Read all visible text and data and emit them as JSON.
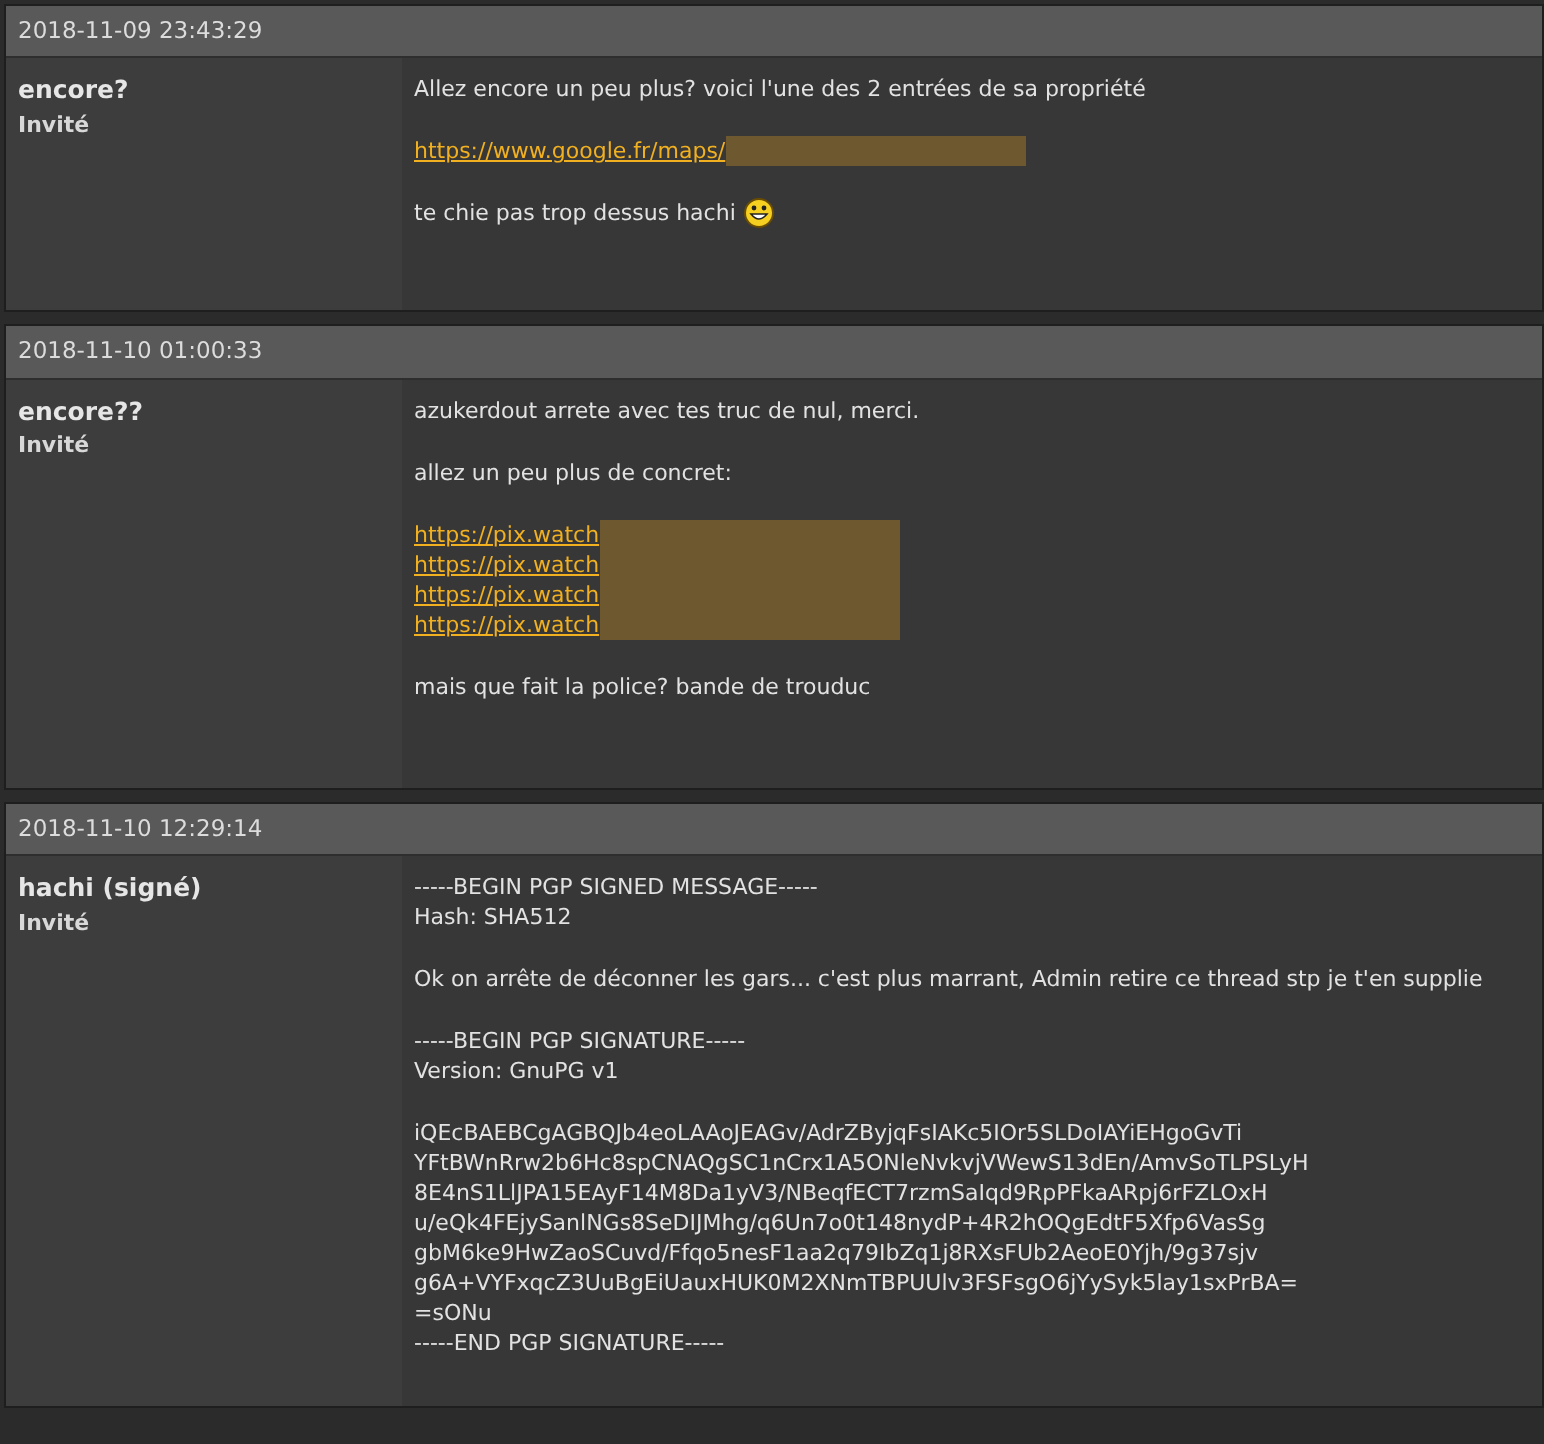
{
  "posts": [
    {
      "date": "2018-11-09 23:43:29",
      "author": "encore?",
      "role": "Invité",
      "paragraphs": [
        [
          {
            "kind": "text",
            "text": "Allez encore un peu plus? voici l'une des 2 entrées de sa propriété"
          }
        ],
        [
          {
            "kind": "link",
            "text": "https://www.google.fr/maps/",
            "redacted": true
          }
        ],
        [
          {
            "kind": "text",
            "text": "te chie pas trop dessus hachi",
            "smiley": true
          }
        ]
      ]
    },
    {
      "date": "2018-11-10 01:00:33",
      "author": "encore??",
      "role": "Invité",
      "paragraphs": [
        [
          {
            "kind": "text",
            "text": "azukerdout arrete avec tes truc de nul, merci."
          }
        ],
        [
          {
            "kind": "text",
            "text": "allez un peu plus de concret:"
          }
        ],
        [
          {
            "kind": "link",
            "text": "https://pix.watch",
            "redacted": true
          },
          {
            "kind": "link",
            "text": "https://pix.watch",
            "redacted": true
          },
          {
            "kind": "link",
            "text": "https://pix.watch",
            "redacted": true
          },
          {
            "kind": "link",
            "text": "https://pix.watch",
            "redacted": true
          }
        ],
        [
          {
            "kind": "text",
            "text": "mais que fait la police? bande de trouduc"
          }
        ]
      ]
    },
    {
      "date": "2018-11-10 12:29:14",
      "author": "hachi (signé)",
      "role": "Invité",
      "paragraphs": [
        [
          {
            "kind": "text",
            "text": "-----BEGIN PGP SIGNED MESSAGE-----"
          },
          {
            "kind": "text",
            "text": "Hash: SHA512"
          }
        ],
        [
          {
            "kind": "text",
            "text": "Ok on arrête de déconner les gars... c'est plus marrant, Admin retire ce thread stp je t'en supplie"
          }
        ],
        [
          {
            "kind": "text",
            "text": "-----BEGIN PGP SIGNATURE-----"
          },
          {
            "kind": "text",
            "text": "Version: GnuPG v1"
          }
        ],
        [
          {
            "kind": "text",
            "text": "iQEcBAEBCgAGBQJb4eoLAAoJEAGv/AdrZByjqFsIAKc5IOr5SLDoIAYiEHgoGvTi"
          },
          {
            "kind": "text",
            "text": "YFtBWnRrw2b6Hc8spCNAQgSC1nCrx1A5ONleNvkvjVWewS13dEn/AmvSoTLPSLyH"
          },
          {
            "kind": "text",
            "text": "8E4nS1LlJPA15EAyF14M8Da1yV3/NBeqfECT7rzmSaIqd9RpPFkaARpj6rFZLOxH"
          },
          {
            "kind": "text",
            "text": "u/eQk4FEjySanlNGs8SeDIJMhg/q6Un7o0t148nydP+4R2hOQgEdtF5Xfp6VasSg"
          },
          {
            "kind": "text",
            "text": "gbM6ke9HwZaoSCuvd/Ffqo5nesF1aa2q79IbZq1j8RXsFUb2AeoE0Yjh/9g37sjv"
          },
          {
            "kind": "text",
            "text": "g6A+VYFxqcZ3UuBgEiUauxHUK0M2XNmTBPUUlv3FSFsgO6jYySyk5lay1sxPrBA="
          },
          {
            "kind": "text",
            "text": "=sONu"
          },
          {
            "kind": "text",
            "text": "-----END PGP SIGNATURE-----"
          }
        ]
      ]
    }
  ]
}
